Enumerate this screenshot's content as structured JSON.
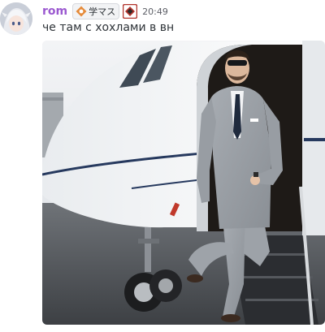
{
  "message": {
    "username": "rom",
    "tag_label": "学マス",
    "timestamp": "20:49",
    "text": "че там с хохлами в вн",
    "colors": {
      "username": "#9b59d0",
      "role_icon": "#b2342c"
    }
  },
  "icons": {
    "avatar": "anime-avatar",
    "tag": "guild-tag-icon",
    "role": "role-badge-icon"
  }
}
